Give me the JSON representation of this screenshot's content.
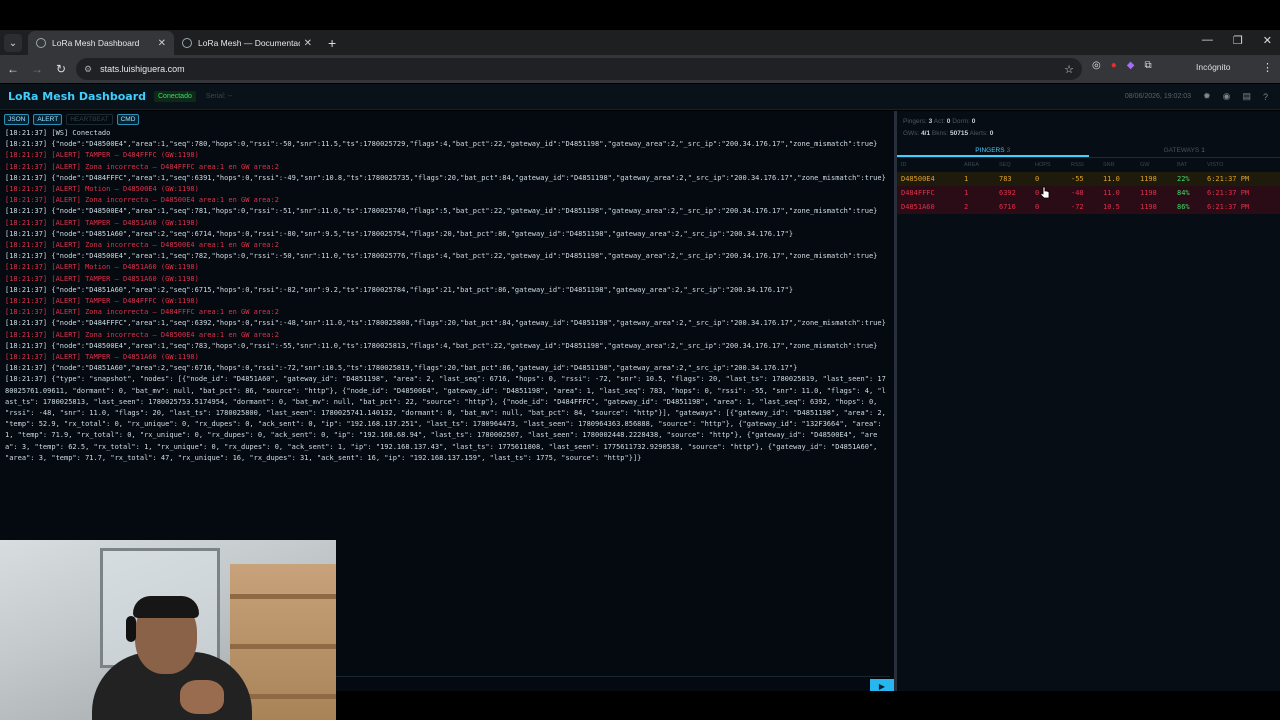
{
  "browser": {
    "tabs": [
      {
        "title": "LoRa Mesh Dashboard",
        "active": true
      },
      {
        "title": "LoRa Mesh — Documentación",
        "active": false
      }
    ],
    "url": "stats.luishiguera.com",
    "incognito_label": "Incógnito"
  },
  "app": {
    "title": "LoRa Mesh Dashboard",
    "status": "Conectado",
    "serial": "Serial: --",
    "datetime": "08/06/2026, 19:02:03"
  },
  "console": {
    "filters": [
      {
        "label": "JSON",
        "active": true
      },
      {
        "label": "ALERT",
        "active": true
      },
      {
        "label": "HEARTBEAT",
        "active": false
      },
      {
        "label": "CMD",
        "active": true
      }
    ],
    "lines": [
      {
        "type": "info",
        "text": "[18:21:37] [WS] Conectado"
      },
      {
        "type": "info",
        "text": "[18:21:37] {\"node\":\"D48500E4\",\"area\":1,\"seq\":780,\"hops\":0,\"rssi\":-50,\"snr\":11.5,\"ts\":1780025729,\"flags\":4,\"bat_pct\":22,\"gateway_id\":\"D4851198\",\"gateway_area\":2,\"_src_ip\":\"200.34.176.17\",\"zone_mismatch\":true}"
      },
      {
        "type": "alert",
        "text": "[18:21:37] [ALERT] TAMPER — D484FFFC (GW:1198)"
      },
      {
        "type": "alert",
        "text": "[18:21:37] [ALERT] Zona incorrecta — D484FFFC area:1 en GW area:2"
      },
      {
        "type": "info",
        "text": "[18:21:37] {\"node\":\"D484FFFC\",\"area\":1,\"seq\":6391,\"hops\":0,\"rssi\":-49,\"snr\":10.8,\"ts\":1780025735,\"flags\":20,\"bat_pct\":84,\"gateway_id\":\"D4851198\",\"gateway_area\":2,\"_src_ip\":\"200.34.176.17\",\"zone_mismatch\":true}"
      },
      {
        "type": "alert",
        "text": "[18:21:37] [ALERT] Motion — D48500E4 (GW:1198)"
      },
      {
        "type": "alert",
        "text": "[18:21:37] [ALERT] Zona incorrecta — D48500E4 area:1 en GW area:2"
      },
      {
        "type": "info",
        "text": "[18:21:37] {\"node\":\"D48500E4\",\"area\":1,\"seq\":781,\"hops\":0,\"rssi\":-51,\"snr\":11.0,\"ts\":1780025740,\"flags\":5,\"bat_pct\":22,\"gateway_id\":\"D4851198\",\"gateway_area\":2,\"_src_ip\":\"200.34.176.17\",\"zone_mismatch\":true}"
      },
      {
        "type": "alert",
        "text": "[18:21:37] [ALERT] TAMPER — D4851A60 (GW:1198)"
      },
      {
        "type": "info",
        "text": "[18:21:37] {\"node\":\"D4851A60\",\"area\":2,\"seq\":6714,\"hops\":0,\"rssi\":-80,\"snr\":9.5,\"ts\":1780025754,\"flags\":20,\"bat_pct\":86,\"gateway_id\":\"D4851198\",\"gateway_area\":2,\"_src_ip\":\"200.34.176.17\"}"
      },
      {
        "type": "alert",
        "text": "[18:21:37] [ALERT] Zona incorrecta — D48500E4 area:1 en GW area:2"
      },
      {
        "type": "info",
        "text": "[18:21:37] {\"node\":\"D48500E4\",\"area\":1,\"seq\":782,\"hops\":0,\"rssi\":-50,\"snr\":11.0,\"ts\":1780025776,\"flags\":4,\"bat_pct\":22,\"gateway_id\":\"D4851198\",\"gateway_area\":2,\"_src_ip\":\"200.34.176.17\",\"zone_mismatch\":true}"
      },
      {
        "type": "alert",
        "text": "[18:21:37] [ALERT] Motion — D4851A60 (GW:1198)"
      },
      {
        "type": "alert",
        "text": "[18:21:37] [ALERT] TAMPER — D4851A60 (GW:1198)"
      },
      {
        "type": "info",
        "text": "[18:21:37] {\"node\":\"D4851A60\",\"area\":2,\"seq\":6715,\"hops\":0,\"rssi\":-82,\"snr\":9.2,\"ts\":1780025784,\"flags\":21,\"bat_pct\":86,\"gateway_id\":\"D4851198\",\"gateway_area\":2,\"_src_ip\":\"200.34.176.17\"}"
      },
      {
        "type": "alert",
        "text": "[18:21:37] [ALERT] TAMPER — D484FFFC (GW:1198)"
      },
      {
        "type": "alert",
        "text": "[18:21:37] [ALERT] Zona incorrecta — D484FFFC area:1 en GW area:2"
      },
      {
        "type": "info",
        "text": "[18:21:37] {\"node\":\"D484FFFC\",\"area\":1,\"seq\":6392,\"hops\":0,\"rssi\":-48,\"snr\":11.0,\"ts\":1780025800,\"flags\":20,\"bat_pct\":84,\"gateway_id\":\"D4851198\",\"gateway_area\":2,\"_src_ip\":\"200.34.176.17\",\"zone_mismatch\":true}"
      },
      {
        "type": "alert",
        "text": "[18:21:37] [ALERT] Zona incorrecta — D48500E4 area:1 en GW area:2"
      },
      {
        "type": "info",
        "text": "[18:21:37] {\"node\":\"D48500E4\",\"area\":1,\"seq\":783,\"hops\":0,\"rssi\":-55,\"snr\":11.0,\"ts\":1780025813,\"flags\":4,\"bat_pct\":22,\"gateway_id\":\"D4851198\",\"gateway_area\":2,\"_src_ip\":\"200.34.176.17\",\"zone_mismatch\":true}"
      },
      {
        "type": "alert",
        "text": "[18:21:37] [ALERT] TAMPER — D4851A60 (GW:1198)"
      },
      {
        "type": "info",
        "text": "[18:21:37] {\"node\":\"D4851A60\",\"area\":2,\"seq\":6716,\"hops\":0,\"rssi\":-72,\"snr\":10.5,\"ts\":1780025819,\"flags\":20,\"bat_pct\":86,\"gateway_id\":\"D4851198\",\"gateway_area\":2,\"_src_ip\":\"200.34.176.17\"}"
      },
      {
        "type": "info",
        "text": "[18:21:37] {\"type\": \"snapshot\", \"nodes\": [{\"node_id\": \"D4851A60\", \"gateway_id\": \"D4851198\", \"area\": 2, \"last_seq\": 6716, \"hops\": 0, \"rssi\": -72, \"snr\": 10.5, \"flags\": 20, \"last_ts\": 1780025819, \"last_seen\": 1780025761.09611, \"dormant\": 0, \"bat_mv\": null, \"bat_pct\": 86, \"source\": \"http\"}, {\"node_id\": \"D48500E4\", \"gateway_id\": \"D4851198\", \"area\": 1, \"last_seq\": 783, \"hops\": 0, \"rssi\": -55, \"snr\": 11.0, \"flags\": 4, \"last_ts\": 1780025813, \"last_seen\": 1780025753.5174954, \"dormant\": 0, \"bat_mv\": null, \"bat_pct\": 22, \"source\": \"http\"}, {\"node_id\": \"D484FFFC\", \"gateway_id\": \"D4851198\", \"area\": 1, \"last_seq\": 6392, \"hops\": 0, \"rssi\": -48, \"snr\": 11.0, \"flags\": 20, \"last_ts\": 1780025800, \"last_seen\": 1780025741.140132, \"dormant\": 0, \"bat_mv\": null, \"bat_pct\": 84, \"source\": \"http\"}], \"gateways\": [{\"gateway_id\": \"D4851198\", \"area\": 2, \"temp\": 52.9, \"rx_total\": 0, \"rx_unique\": 0, \"rx_dupes\": 0, \"ack_sent\": 0, \"ip\": \"192.168.137.251\", \"last_ts\": 1780964473, \"last_seen\": 1780964363.856888, \"source\": \"http\"}, {\"gateway_id\": \"132F3664\", \"area\": 1, \"temp\": 71.9, \"rx_total\": 0, \"rx_unique\": 0, \"rx_dupes\": 0, \"ack_sent\": 0, \"ip\": \"192.168.68.94\", \"last_ts\": 1780002507, \"last_seen\": 1780002448.2228438, \"source\": \"http\"}, {\"gateway_id\": \"D48500E4\", \"area\": 3, \"temp\": 62.5, \"rx_total\": 1, \"rx_unique\": 0, \"rx_dupes\": 0, \"ack_sent\": 1, \"ip\": \"192.168.137.43\", \"last_ts\": 1775611808, \"last_seen\": 1775611732.9290538, \"source\": \"http\"}, {\"gateway_id\": \"D4851A60\", \"area\": 3, \"temp\": 71.7, \"rx_total\": 47, \"rx_unique\": 16, \"rx_dupes\": 31, \"ack_sent\": 16, \"ip\": \"192.168.137.159\", \"last_ts\": 1775, \"source\": \"http\"}]}"
      }
    ]
  },
  "stats": {
    "pingers_label": "Pingers:",
    "pingers": "3",
    "act_label": "Act:",
    "act": "0",
    "dorm_label": "Dorm:",
    "dorm": "0",
    "gws_label": "GWs:",
    "gws": "4/1",
    "bkns_label": "Bkns:",
    "bkns": "50715",
    "alerts_label": "Alerts:",
    "alerts": "0"
  },
  "panel_tabs": [
    {
      "label": "PINGERS",
      "count": "3"
    },
    {
      "label": "GATEWAYS",
      "count": "1"
    }
  ],
  "table": {
    "headers": [
      "ID",
      "AREA",
      "SEQ",
      "HOPS",
      "RSSI",
      "SNR",
      "GW",
      "BAT",
      "VISTO"
    ],
    "rows": [
      {
        "id": "D48500E4",
        "area": "1",
        "seq": "783",
        "hops": "0",
        "rssi": "-55",
        "snr": "11.0",
        "gw": "1198",
        "bat": "22%",
        "seen": "6:21:37 PM",
        "state": "warn"
      },
      {
        "id": "D484FFFC",
        "area": "1",
        "seq": "6392",
        "hops": "0",
        "rssi": "-48",
        "snr": "11.0",
        "gw": "1198",
        "bat": "84%",
        "seen": "6:21:37 PM",
        "state": "bad"
      },
      {
        "id": "D4851A60",
        "area": "2",
        "seq": "6716",
        "hops": "0",
        "rssi": "-72",
        "snr": "10.5",
        "gw": "1198",
        "bat": "86%",
        "seen": "6:21:37 PM",
        "state": "bad"
      }
    ]
  },
  "colors": {
    "accent": "#3fd0ff",
    "alert": "#e0304a",
    "ok": "#3ddc6a",
    "warn": "#e0a32a"
  }
}
